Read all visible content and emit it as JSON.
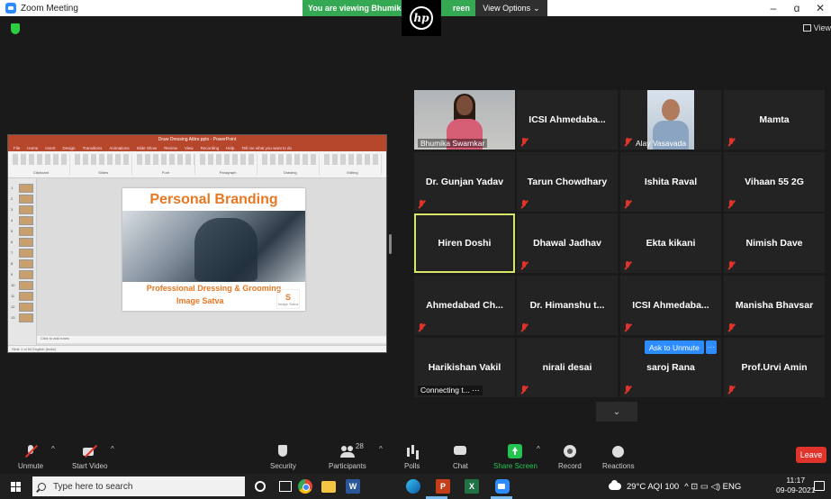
{
  "window": {
    "title": "Zoom Meeting",
    "minimize": "–",
    "maximize": "ɑ",
    "close": "✕",
    "view_label": "View"
  },
  "share_banner": {
    "viewing_text": "You are viewing Bhumika S",
    "viewing_suffix": "reen",
    "view_options": "View Options",
    "chevron": "⌄"
  },
  "hp_logo_text": "hp",
  "shared_screen": {
    "app_title": "Draw Dressing Attire.pptx - PowerPoint",
    "tabs": [
      "File",
      "Home",
      "Insert",
      "Design",
      "Transitions",
      "Animations",
      "Slide Show",
      "Review",
      "View",
      "Recording",
      "Help",
      "Tell me what you want to do"
    ],
    "ribbon_groups": [
      "Clipboard",
      "Slides",
      "Font",
      "Paragraph",
      "Drawing",
      "Editing"
    ],
    "slide_numbers": [
      "1",
      "2",
      "3",
      "4",
      "5",
      "6",
      "7",
      "8",
      "9",
      "10",
      "11",
      "12",
      "13"
    ],
    "slide_title": "Personal Branding",
    "slide_subtitle": "Professional Dressing & Grooming",
    "slide_brand": "Image Satva",
    "slide_logo_mark": "S",
    "slide_logo_text": "Image Satva",
    "notes_placeholder": "Click to add notes",
    "status_text": "Slide 1 of 54    English (India)"
  },
  "participants": [
    {
      "name": "Bhumika Swarnkar",
      "video": "woman",
      "muted": false
    },
    {
      "name": "ICSI  Ahmedaba...",
      "video": "none",
      "muted": true
    },
    {
      "name": "Alay Vasavada",
      "video": "man",
      "muted": true
    },
    {
      "name": "Mamta",
      "video": "none",
      "muted": true
    },
    {
      "name": "Dr. Gunjan Yadav",
      "video": "none",
      "muted": true
    },
    {
      "name": "Tarun Chowdhary",
      "video": "none",
      "muted": true
    },
    {
      "name": "Ishita Raval",
      "video": "none",
      "muted": true
    },
    {
      "name": "Vihaan 55 2G",
      "video": "none",
      "muted": true
    },
    {
      "name": "Hiren Doshi",
      "video": "none",
      "muted": false,
      "active": true
    },
    {
      "name": "Dhawal Jadhav",
      "video": "none",
      "muted": true
    },
    {
      "name": "Ekta kikani",
      "video": "none",
      "muted": true
    },
    {
      "name": "Nimish Dave",
      "video": "none",
      "muted": true
    },
    {
      "name": "Ahmedabad  Ch...",
      "video": "none",
      "muted": true
    },
    {
      "name": "Dr. Himanshu  t...",
      "video": "none",
      "muted": true
    },
    {
      "name": "ICSI  Ahmedaba...",
      "video": "none",
      "muted": true
    },
    {
      "name": "Manisha Bhavsar",
      "video": "none",
      "muted": true
    },
    {
      "name": "Harikishan Vakil",
      "video": "none",
      "muted": false,
      "status": "Connecting t... ⋯"
    },
    {
      "name": "nirali desai",
      "video": "none",
      "muted": true
    },
    {
      "name": "saroj Rana",
      "video": "none",
      "muted": true
    },
    {
      "name": "Prof.Urvi Amin",
      "video": "none",
      "muted": true
    }
  ],
  "unmute_request": {
    "label": "Ask to Unmute",
    "more": "···"
  },
  "gallery_next": "⌄",
  "controls": {
    "unmute": "Unmute",
    "start_video": "Start Video",
    "security": "Security",
    "participants": "Participants",
    "participant_count": "28",
    "polls": "Polls",
    "chat": "Chat",
    "share_screen": "Share Screen",
    "record": "Record",
    "reactions": "Reactions",
    "leave": "Leave",
    "caret": "^"
  },
  "taskbar": {
    "search_placeholder": "Type here to search",
    "word_letter": "W",
    "ppt_letter": "P",
    "excel_letter": "X",
    "weather": "29°C  AQI 100",
    "tray_symbols": "^  ⊡  ▭  ◁)  ENG",
    "time": "11:17",
    "date": "09-09-2021"
  },
  "colors": {
    "zoom_blue": "#2d8cff",
    "share_green": "#23c551",
    "leave_red": "#e0332b",
    "active_speaker": "#d7e66a",
    "viewing_banner": "#34a853"
  }
}
